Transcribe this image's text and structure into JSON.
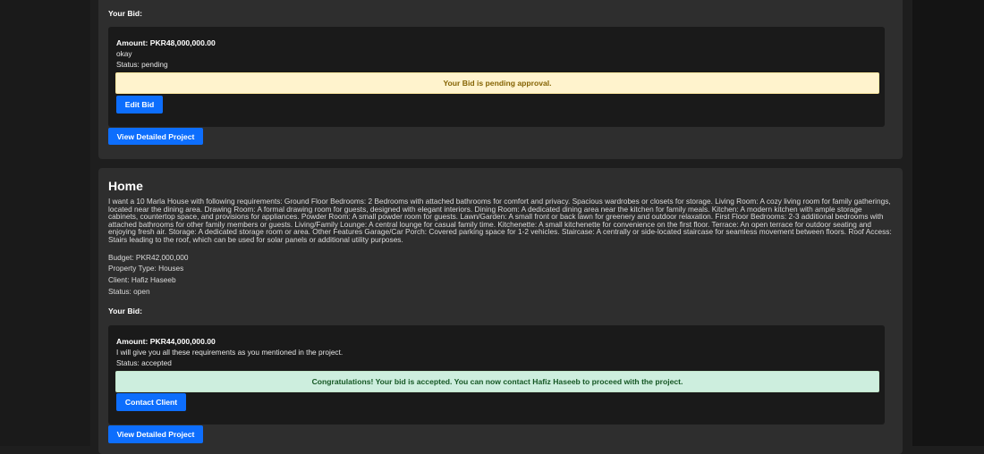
{
  "card1": {
    "your_bid_label": "Your Bid:",
    "bid": {
      "amount": "Amount: PKR48,000,000.00",
      "message": "okay",
      "status": "Status: pending",
      "alert": "Your Bid is pending approval.",
      "action_label": "Edit Bid"
    },
    "view_project_label": "View Detailed Project"
  },
  "card2": {
    "title": "Home",
    "description": "I want a 10 Marla House with following requirements: Ground Floor Bedrooms: 2 Bedrooms with attached bathrooms for comfort and privacy. Spacious wardrobes or closets for storage. Living Room: A cozy living room for family gatherings, located near the dining area. Drawing Room: A formal drawing room for guests, designed with elegant interiors. Dining Room: A dedicated dining area near the kitchen for family meals. Kitchen: A modern kitchen with ample storage cabinets, countertop space, and provisions for appliances. Powder Room: A small powder room for guests. Lawn/Garden: A small front or back lawn for greenery and outdoor relaxation. First Floor Bedrooms: 2-3 additional bedrooms with attached bathrooms for other family members or guests. Living/Family Lounge: A central lounge for casual family time. Kitchenette: A small kitchenette for convenience on the first floor. Terrace: An open terrace for outdoor seating and enjoying fresh air. Storage: A dedicated storage room or area. Other Features Garage/Car Porch: Covered parking space for 1-2 vehicles. Staircase: A centrally or side-located staircase for seamless movement between floors. Roof Access: Stairs leading to the roof, which can be used for solar panels or additional utility purposes.",
    "budget": "Budget: PKR42,000,000",
    "property_type": "Property Type: Houses",
    "client": "Client: Hafiz Haseeb",
    "status": "Status: open",
    "your_bid_label": "Your Bid:",
    "bid": {
      "amount": "Amount: PKR44,000,000.00",
      "message": "I will give you all these requirements as you mentioned in the project.",
      "status": "Status: accepted",
      "alert": "Congratulations! Your bid is accepted. You can now contact Hafiz Haseeb to proceed with the project.",
      "action_label": "Contact Client"
    },
    "view_project_label": "View Detailed Project"
  },
  "colors": {
    "primary": "#0d6efd",
    "warning_bg": "#fff3cd",
    "success_bg": "#cdeede",
    "card_bg": "#2e2e2e",
    "bid_box_bg": "#1a1a1a"
  }
}
